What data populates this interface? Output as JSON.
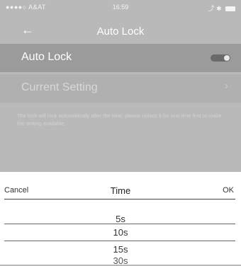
{
  "status_bar": {
    "carrier": "●●●●○ A&AT",
    "time": "16:59",
    "right_icons": "⤴ ✱"
  },
  "nav": {
    "back_icon": "←",
    "title": "Auto Lock"
  },
  "settings": {
    "auto_lock_label": "Auto Lock",
    "auto_lock_on": true,
    "current_setting_label": "Current Setting",
    "chevron": "›",
    "hint": "The lock will lock automatically after the time, please unlock it for one time first to make the setting available."
  },
  "sheet": {
    "cancel": "Cancel",
    "title": "Time",
    "ok": "OK",
    "options": [
      "5s",
      "10s",
      "15s",
      "30s"
    ]
  }
}
